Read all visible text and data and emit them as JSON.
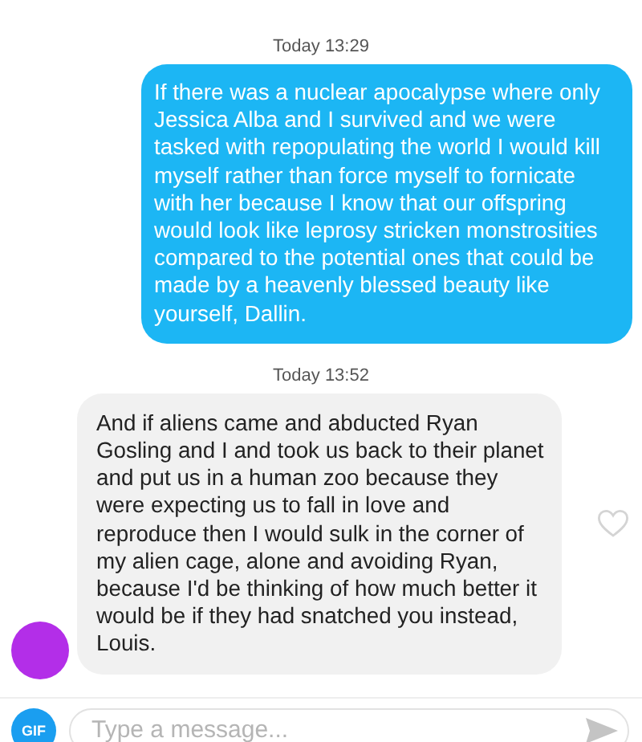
{
  "messages": [
    {
      "timestamp": "Today 13:29",
      "kind": "sent",
      "text": "If there was a nuclear apocalypse where only Jessica Alba and I survived and we were tasked with repopulating the world I would kill myself rather than force myself to fornicate with her because I know that our offspring would look like leprosy stricken monstrosities compared to the potential ones that could be made by a heavenly blessed beauty like yourself, Dallin."
    },
    {
      "timestamp": "Today 13:52",
      "kind": "received",
      "liked": false,
      "text": "And if aliens came and abducted Ryan Gosling and I and took us back to their planet and put us in a human zoo because they were expecting us to fall in love and reproduce then I would sulk in the corner of my alien cage, alone and avoiding Ryan, because I'd be thinking of how much better it would be if they had snatched you instead, Louis."
    }
  ],
  "composer": {
    "gif_button": "GIF",
    "placeholder": "Type a message..."
  }
}
